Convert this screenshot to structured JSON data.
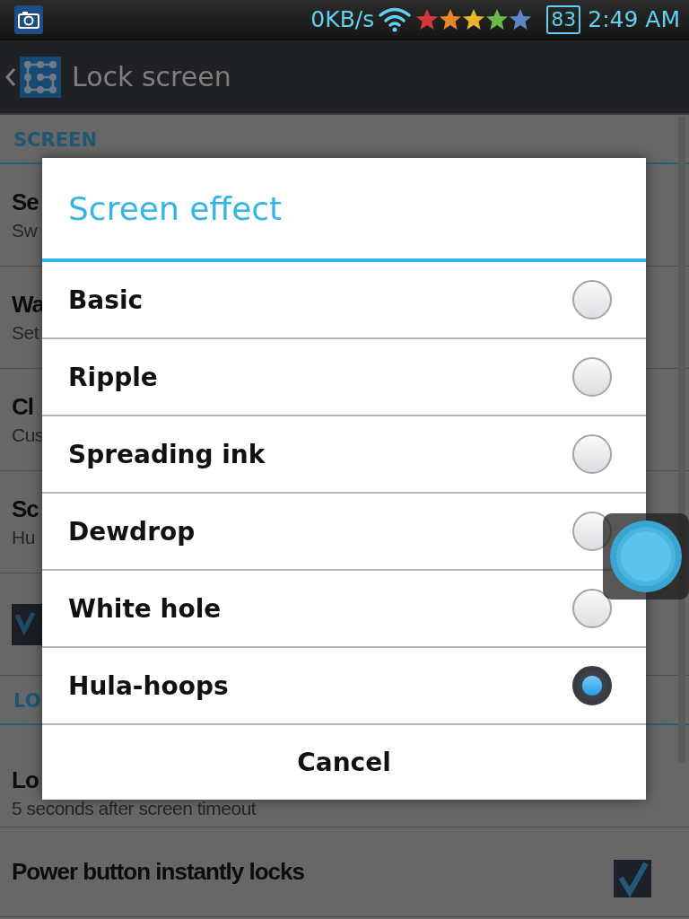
{
  "status_bar": {
    "net_speed": "0KB/s",
    "battery": "83",
    "time": "2:49 AM"
  },
  "header": {
    "title": "Lock screen"
  },
  "sections": [
    {
      "title": "SCREEN",
      "rows": [
        {
          "kind": "text",
          "title": "Se",
          "subtitle": "Sw"
        },
        {
          "kind": "text",
          "title": "Wa",
          "subtitle": "Set"
        },
        {
          "kind": "text",
          "title": "Cl",
          "subtitle": "Cus"
        },
        {
          "kind": "text",
          "title": "Sc",
          "subtitle": "Hu"
        },
        {
          "kind": "widget"
        }
      ]
    },
    {
      "title": "LO",
      "rows": [
        {
          "kind": "text",
          "title": "Lo",
          "subtitle": "5 seconds after screen timeout"
        },
        {
          "kind": "checkbox",
          "title": "Power button instantly locks",
          "checked": true
        }
      ]
    }
  ],
  "dialog": {
    "title": "Screen effect",
    "options": [
      {
        "label": "Basic",
        "selected": false
      },
      {
        "label": "Ripple",
        "selected": false
      },
      {
        "label": "Spreading ink",
        "selected": false
      },
      {
        "label": "Dewdrop",
        "selected": false
      },
      {
        "label": "White hole",
        "selected": false
      },
      {
        "label": "Hula-hoops",
        "selected": true
      }
    ],
    "cancel": "Cancel"
  }
}
